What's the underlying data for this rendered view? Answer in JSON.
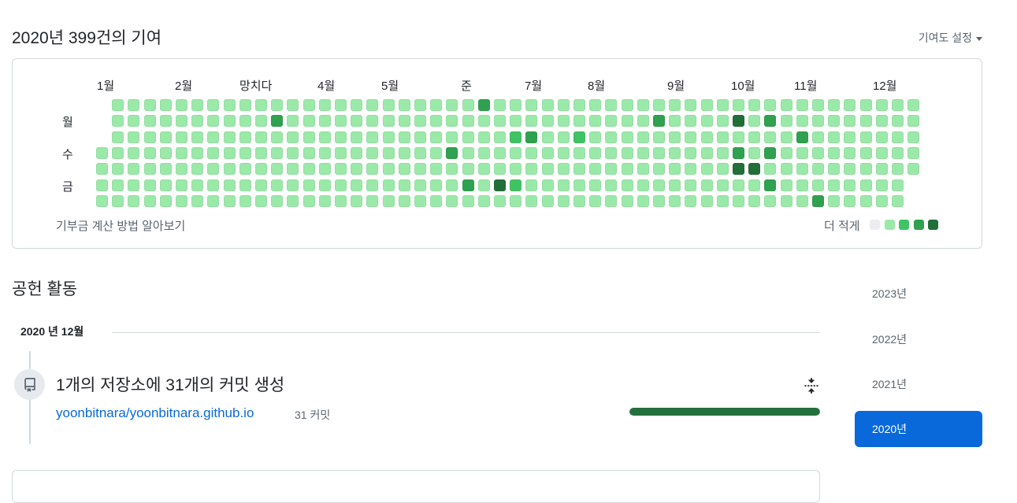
{
  "header": {
    "title": "2020년 399건의 기여",
    "settings_label": "기여도 설정"
  },
  "graph": {
    "months": [
      "1월",
      "2월",
      "망치다",
      "4월",
      "5월",
      "준",
      "7월",
      "8월",
      "9월",
      "10월",
      "11월",
      "12월"
    ],
    "day_labels": [
      "월",
      "수",
      "금"
    ],
    "learn_link": "기부금 계산 방법 알아보기",
    "legend_less": "더 적게",
    "colors": [
      "#ebedf0",
      "#9be9a8",
      "#40c463",
      "#30a14e",
      "#216e39"
    ],
    "weeks": [
      [
        null,
        null,
        null,
        1,
        1,
        1,
        1
      ],
      [
        1,
        1,
        1,
        1,
        1,
        1,
        1
      ],
      [
        1,
        1,
        1,
        1,
        1,
        1,
        1
      ],
      [
        1,
        1,
        1,
        1,
        1,
        1,
        1
      ],
      [
        1,
        1,
        1,
        1,
        1,
        1,
        1
      ],
      [
        1,
        1,
        1,
        1,
        1,
        1,
        1
      ],
      [
        1,
        1,
        1,
        1,
        1,
        1,
        1
      ],
      [
        1,
        1,
        1,
        1,
        1,
        1,
        1
      ],
      [
        1,
        1,
        1,
        1,
        1,
        1,
        1
      ],
      [
        1,
        1,
        1,
        1,
        1,
        1,
        1
      ],
      [
        1,
        1,
        1,
        1,
        1,
        1,
        1
      ],
      [
        1,
        3,
        1,
        1,
        1,
        1,
        1
      ],
      [
        1,
        1,
        1,
        1,
        1,
        1,
        1
      ],
      [
        1,
        1,
        1,
        1,
        1,
        1,
        1
      ],
      [
        1,
        1,
        1,
        1,
        1,
        1,
        1
      ],
      [
        1,
        1,
        1,
        1,
        1,
        1,
        1
      ],
      [
        1,
        1,
        1,
        1,
        1,
        1,
        1
      ],
      [
        1,
        1,
        1,
        1,
        1,
        1,
        1
      ],
      [
        1,
        1,
        1,
        1,
        1,
        1,
        1
      ],
      [
        1,
        1,
        1,
        1,
        1,
        1,
        1
      ],
      [
        1,
        1,
        1,
        1,
        1,
        1,
        1
      ],
      [
        1,
        1,
        1,
        1,
        1,
        1,
        1
      ],
      [
        1,
        1,
        1,
        3,
        1,
        1,
        1
      ],
      [
        1,
        1,
        1,
        1,
        1,
        3,
        1
      ],
      [
        3,
        1,
        1,
        1,
        1,
        1,
        1
      ],
      [
        1,
        1,
        1,
        1,
        1,
        4,
        1
      ],
      [
        1,
        1,
        2,
        1,
        1,
        2,
        1
      ],
      [
        1,
        1,
        3,
        1,
        1,
        1,
        1
      ],
      [
        1,
        1,
        1,
        1,
        1,
        1,
        1
      ],
      [
        1,
        1,
        1,
        1,
        1,
        1,
        1
      ],
      [
        1,
        1,
        2,
        1,
        1,
        1,
        1
      ],
      [
        1,
        1,
        1,
        1,
        1,
        1,
        1
      ],
      [
        1,
        1,
        1,
        1,
        1,
        1,
        1
      ],
      [
        1,
        1,
        1,
        1,
        1,
        1,
        1
      ],
      [
        1,
        1,
        1,
        1,
        1,
        1,
        1
      ],
      [
        1,
        3,
        1,
        1,
        1,
        1,
        1
      ],
      [
        1,
        1,
        1,
        1,
        1,
        1,
        1
      ],
      [
        1,
        1,
        1,
        1,
        1,
        1,
        1
      ],
      [
        1,
        1,
        1,
        1,
        1,
        1,
        1
      ],
      [
        1,
        1,
        1,
        1,
        1,
        1,
        1
      ],
      [
        1,
        4,
        1,
        3,
        4,
        1,
        1
      ],
      [
        1,
        1,
        1,
        1,
        4,
        1,
        1
      ],
      [
        1,
        3,
        1,
        3,
        1,
        3,
        1
      ],
      [
        1,
        1,
        1,
        1,
        1,
        1,
        1
      ],
      [
        1,
        1,
        3,
        1,
        1,
        1,
        1
      ],
      [
        1,
        1,
        1,
        1,
        1,
        1,
        3
      ],
      [
        1,
        1,
        1,
        1,
        1,
        1,
        1
      ],
      [
        1,
        1,
        1,
        1,
        1,
        1,
        1
      ],
      [
        1,
        1,
        1,
        1,
        1,
        1,
        1
      ],
      [
        1,
        1,
        1,
        1,
        1,
        1,
        1
      ],
      [
        1,
        1,
        1,
        1,
        1,
        1,
        1
      ],
      [
        1,
        1,
        1,
        1,
        1,
        null,
        null
      ]
    ]
  },
  "activity": {
    "title": "공헌 활동",
    "month_heading": "2020 년 12월",
    "event": {
      "title": "1개의 저장소에 31개의 커밋 생성",
      "icon": "repo-push-icon",
      "collapse_icon": "fold-icon",
      "repo": "yoonbitnara/yoonbitnara.github.io",
      "commits": "31 커밋",
      "progress_fraction": 1.0
    }
  },
  "years": [
    {
      "label": "2023년",
      "active": false
    },
    {
      "label": "2022년",
      "active": false
    },
    {
      "label": "2021년",
      "active": false
    },
    {
      "label": "2020년",
      "active": true
    }
  ]
}
